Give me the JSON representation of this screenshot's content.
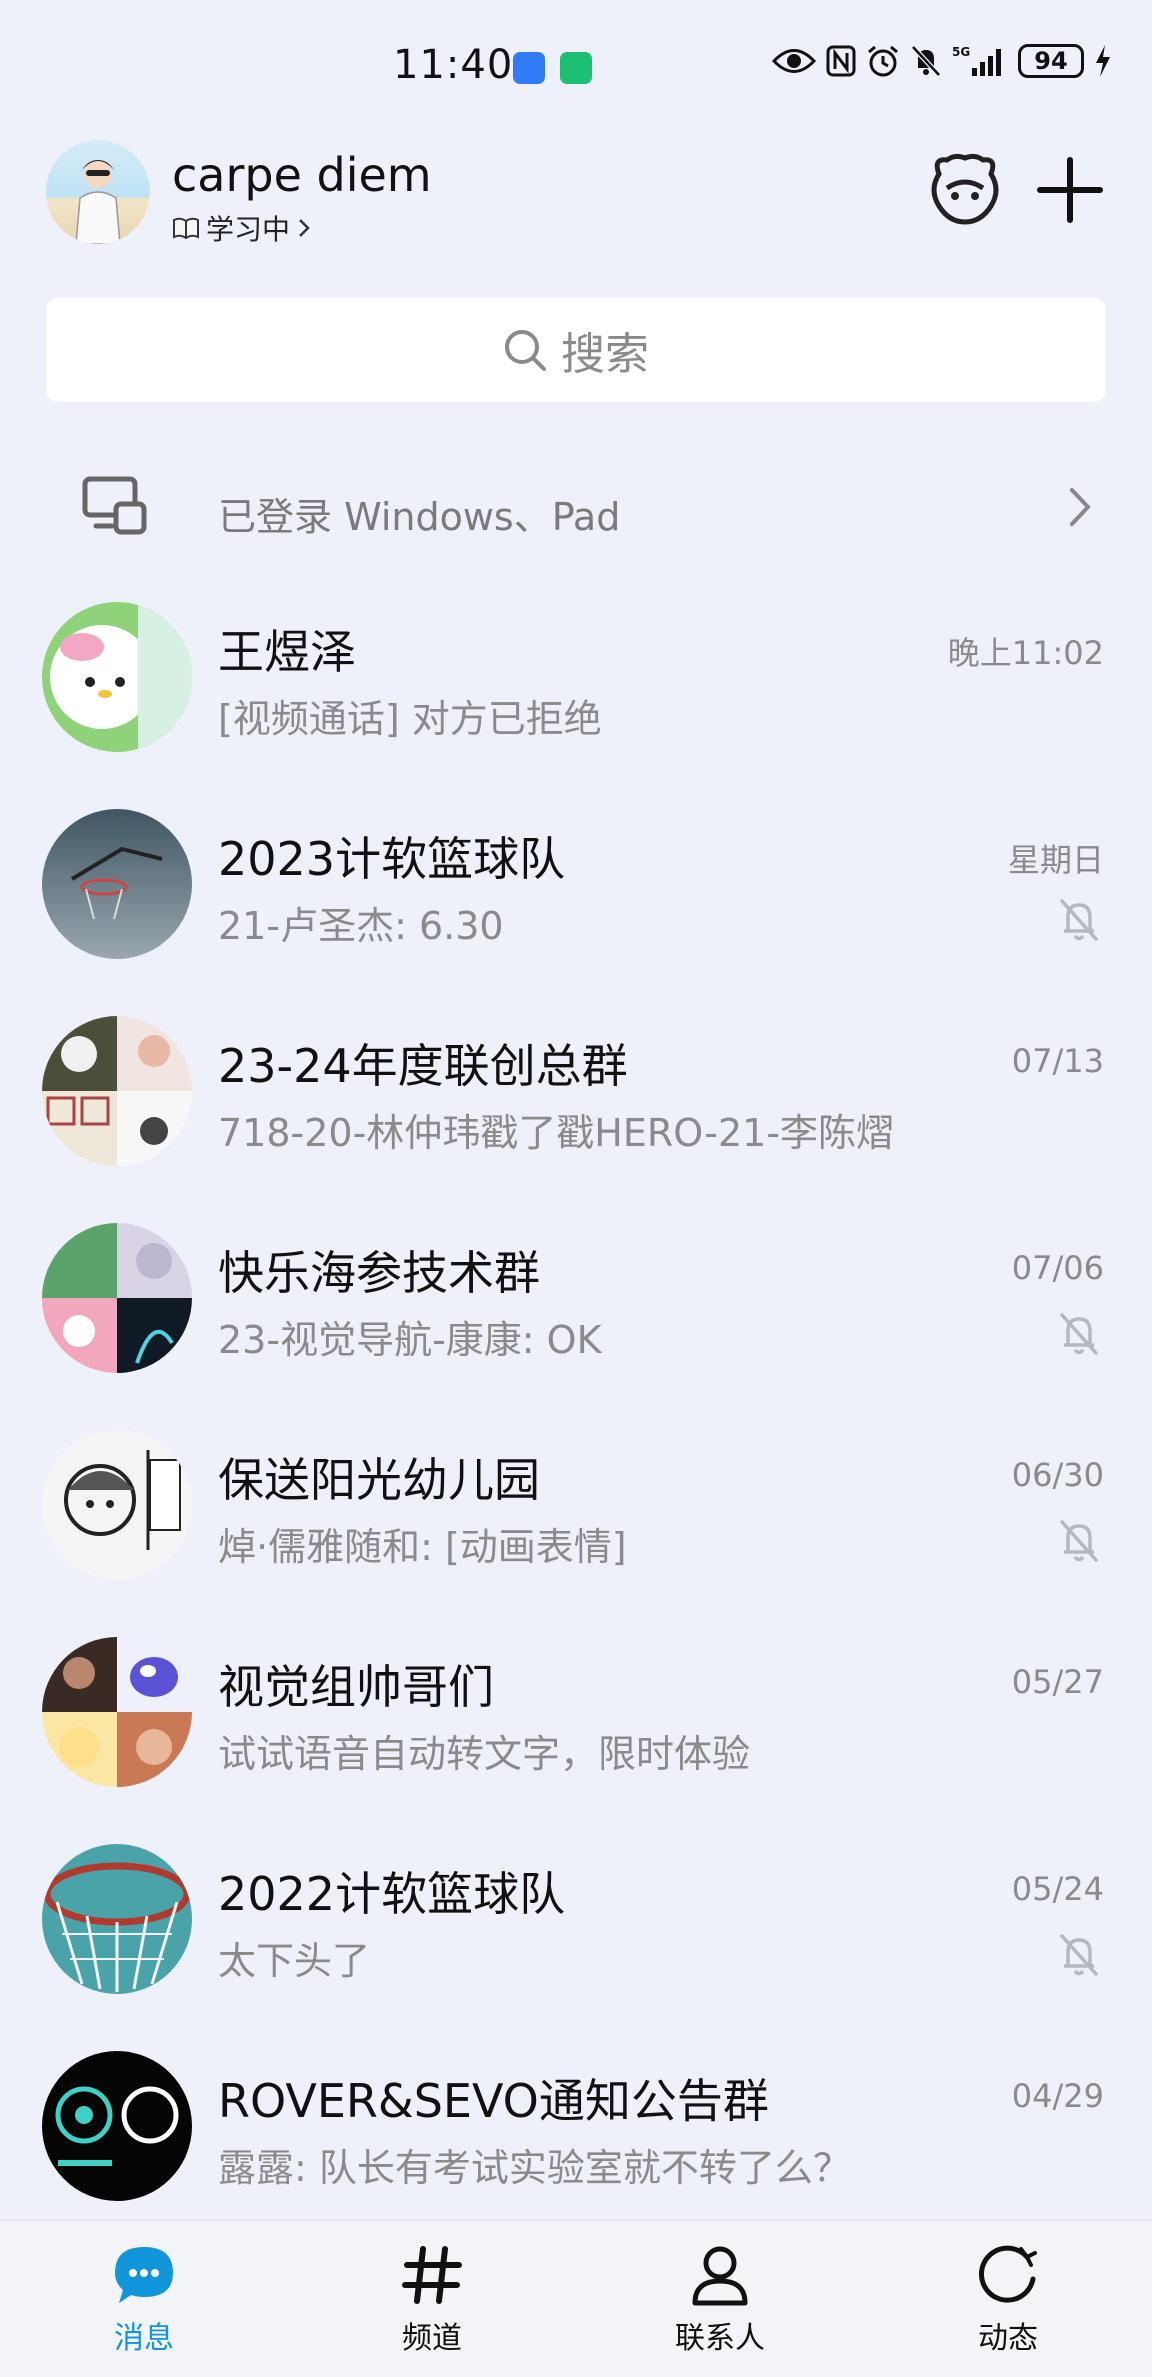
{
  "status_bar": {
    "time": "11:40",
    "battery": "94"
  },
  "header": {
    "nickname": "carpe diem",
    "presence": "学习中"
  },
  "search": {
    "placeholder": "搜索"
  },
  "login_status": {
    "text": "已登录 Windows、Pad"
  },
  "conversations": [
    {
      "name": "王煜泽",
      "preview": "[视频通话] 对方已拒绝",
      "time": "晚上11:02",
      "muted": false
    },
    {
      "name": "2023计软篮球队",
      "preview": "21-卢圣杰: 6.30",
      "time": "星期日",
      "muted": true
    },
    {
      "name": "23-24年度联创总群",
      "preview": "718-20-林仲玮戳了戳HERO-21-李陈熠",
      "time": "07/13",
      "muted": false
    },
    {
      "name": "快乐海参技术群",
      "preview": "23-视觉导航-康康: OK",
      "time": "07/06",
      "muted": true
    },
    {
      "name": "保送阳光幼儿园",
      "preview": "焯·儒雅随和: [动画表情]",
      "time": "06/30",
      "muted": true
    },
    {
      "name": "视觉组帅哥们",
      "preview": "试试语音自动转文字，限时体验",
      "time": "05/27",
      "muted": false
    },
    {
      "name": "2022计软篮球队",
      "preview": "太下头了",
      "time": "05/24",
      "muted": true
    },
    {
      "name": "ROVER&SEVO通知公告群",
      "preview": "露露: 队长有考试实验室就不转了么？",
      "time": "04/29",
      "muted": false
    }
  ],
  "bottom_nav": [
    {
      "label": "消息",
      "icon": "message-icon",
      "active": true
    },
    {
      "label": "频道",
      "icon": "hash-icon",
      "active": false
    },
    {
      "label": "联系人",
      "icon": "contact-icon",
      "active": false
    },
    {
      "label": "动态",
      "icon": "moments-icon",
      "active": false
    }
  ],
  "colors": {
    "accent": "#1296db",
    "background": "#eef1fa",
    "muted_text": "#8a8a8a"
  }
}
